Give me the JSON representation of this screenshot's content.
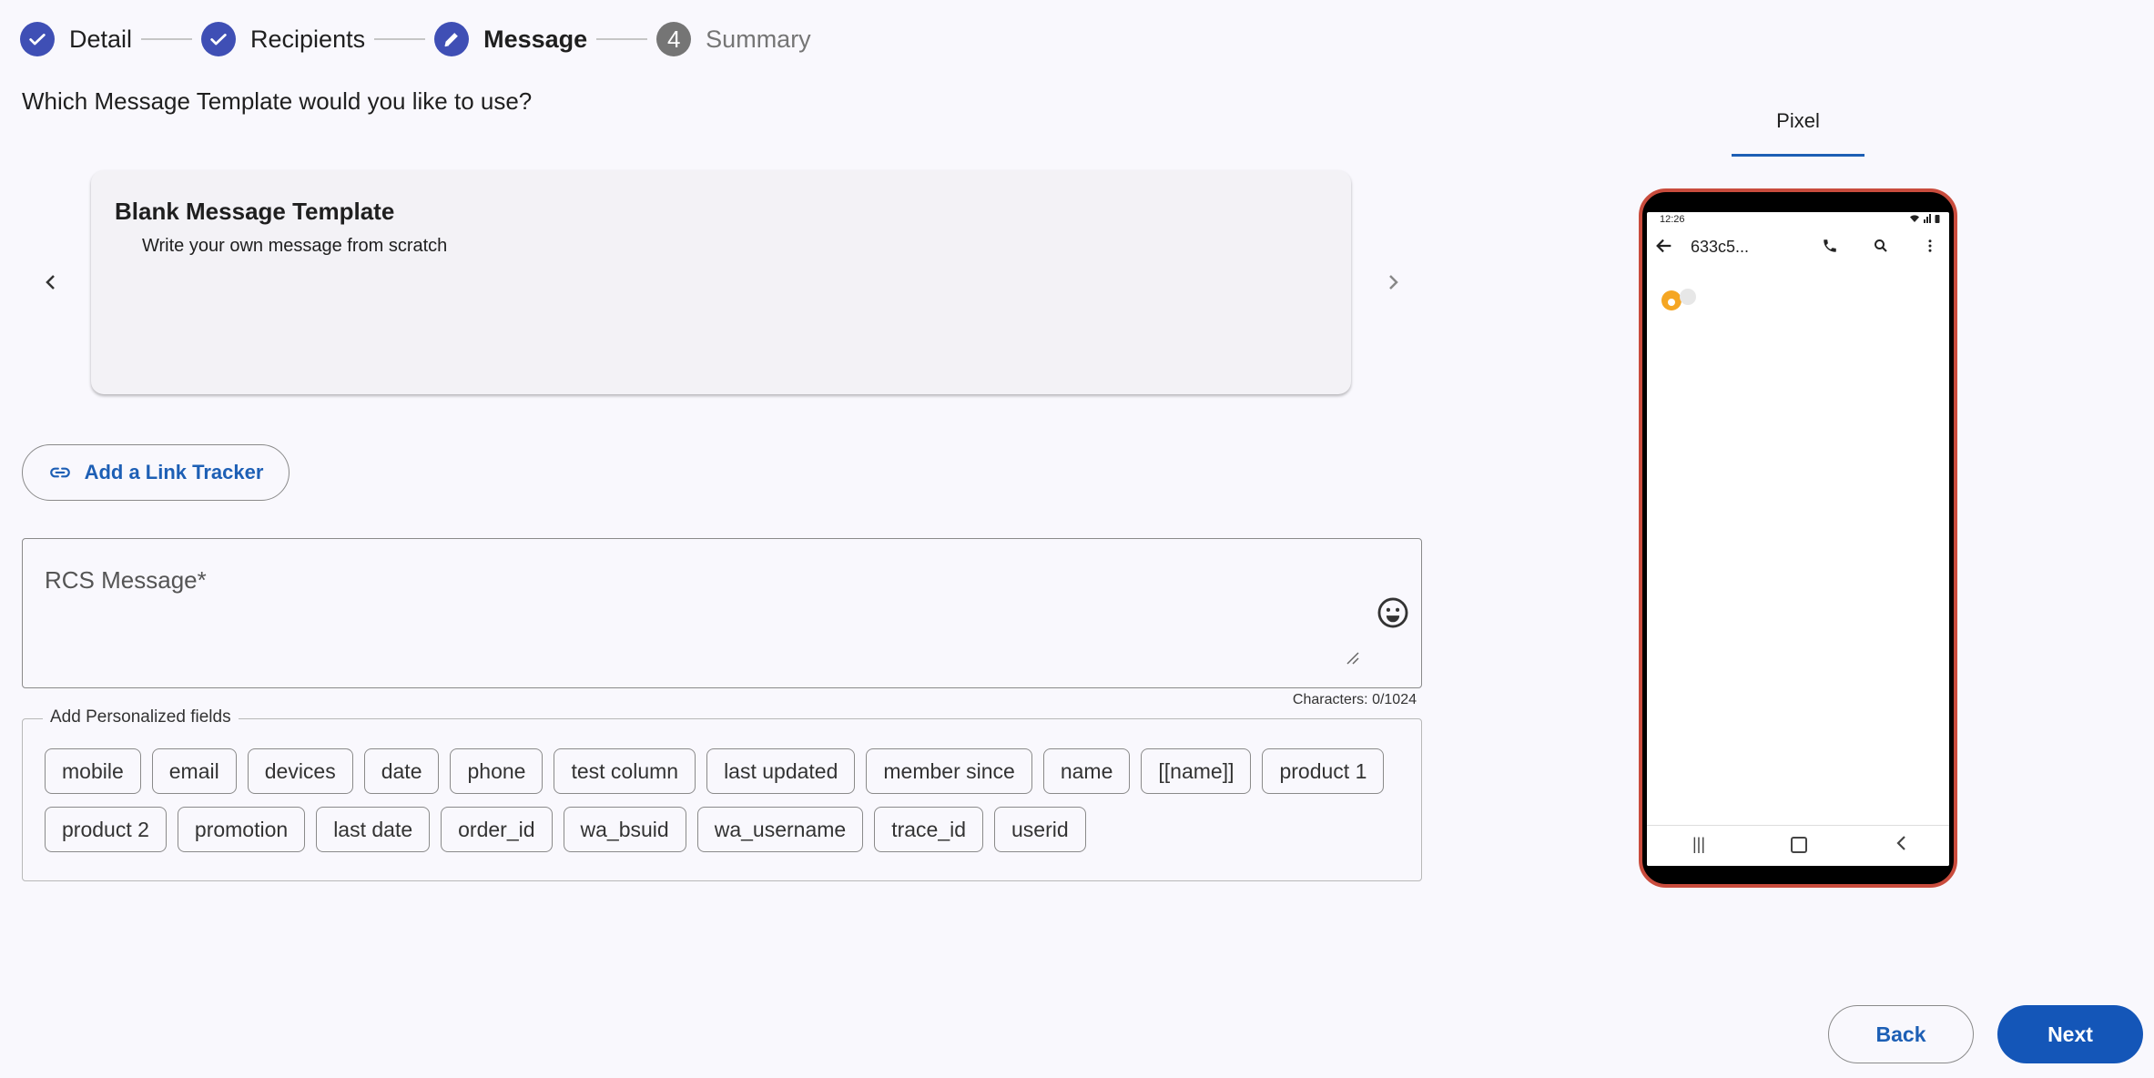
{
  "stepper": {
    "steps": [
      {
        "label": "Detail",
        "state": "done"
      },
      {
        "label": "Recipients",
        "state": "done"
      },
      {
        "label": "Message",
        "state": "active"
      },
      {
        "label": "Summary",
        "state": "pending",
        "number": "4"
      }
    ]
  },
  "question": "Which Message Template would you like to use?",
  "template": {
    "title": "Blank Message Template",
    "description": "Write your own message from scratch"
  },
  "link_tracker": {
    "label": "Add a Link Tracker",
    "icon": "link-icon"
  },
  "message": {
    "placeholder": "RCS Message*",
    "char_count": "Characters: 0/1024",
    "emoji_icon": "smiley-icon"
  },
  "personalized": {
    "legend": "Add Personalized fields",
    "fields": [
      "mobile",
      "email",
      "devices",
      "date",
      "phone",
      "test column",
      "last updated",
      "member since",
      "name",
      "[[name]]",
      "product 1",
      "product 2",
      "promotion",
      "last date",
      "order_id",
      "wa_bsuid",
      "wa_username",
      "trace_id",
      "userid"
    ]
  },
  "preview": {
    "tab_label": "Pixel",
    "phone": {
      "time": "12:26",
      "contact": "633c5...",
      "frame_color": "#c94c3d"
    }
  },
  "buttons": {
    "back": "Back",
    "next": "Next"
  },
  "colors": {
    "accent": "#3f4fb5",
    "primary": "#1456b8",
    "link": "#1d5fb5"
  }
}
